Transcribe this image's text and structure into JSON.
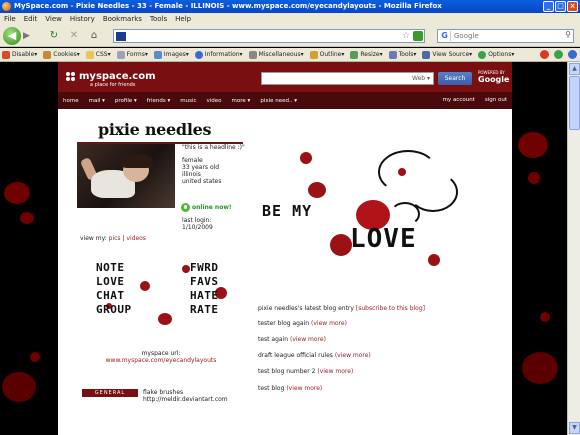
{
  "browser": {
    "title": "MySpace.com - Pixie Needles - 33 - Female - ILLINOIS - www.myspace.com/eyecandylayouts - Mozilla Firefox",
    "window_buttons": [
      "_",
      "□",
      "×"
    ],
    "menu": [
      "File",
      "Edit",
      "View",
      "History",
      "Bookmarks",
      "Tools",
      "Help"
    ],
    "search_placeholder": "Google",
    "webdev_toolbar": [
      "Disable▾",
      "Cookies▾",
      "CSS▾",
      "Forms▾",
      "Images▾",
      "Information▾",
      "Miscellaneous▾",
      "Outline▾",
      "Resize▾",
      "Tools▾",
      "View Source▾",
      "Options▾"
    ]
  },
  "myspace": {
    "logo": "myspace.com",
    "tagline": "a place for friends",
    "search_scope": "Web ▾",
    "search_button": "Search",
    "powered_by": "POWERED BY",
    "google": "Google",
    "nav": [
      "home",
      "mail ▾",
      "profile ▾",
      "friends ▾",
      "music",
      "video",
      "more ▾",
      "pixie need.. ▾"
    ],
    "nav_right": [
      "my account",
      "sign out"
    ]
  },
  "profile": {
    "name": "pixie needles",
    "headline": "\"this is a headline :)\"",
    "gender": "female",
    "age": "33 years old",
    "state": "illinois",
    "country": "united states",
    "online_now": "online now!",
    "last_login_label": "last login:",
    "last_login": "1/10/2009",
    "view_my": "view my:",
    "pics": "pics",
    "sep": "|",
    "videos": "videos"
  },
  "graphic_left": {
    "words_left": [
      "NOTE",
      "LOVE",
      "CHAT",
      "GROUP"
    ],
    "words_right": [
      "FWRD",
      "FAVS",
      "HATE",
      "RATE"
    ]
  },
  "graphic_love": {
    "be_my": "BE MY",
    "love": "LOVE"
  },
  "myspace_url": {
    "label": "myspace url:",
    "url": "www.myspace.com/eyecandylayouts"
  },
  "blog": {
    "heading": "pixie needles's latest blog entry",
    "subscribe": "[subscribe to this blog]",
    "view_more": "(view more)",
    "entries": [
      "tester blog again",
      "test again",
      "draft league official rules",
      "test blog number 2",
      "test blog"
    ]
  },
  "general": {
    "label": "GENERAL",
    "line1": "flake brushes",
    "line2": "http://meldir.deviantart.com"
  },
  "colors": {
    "accent": "#7a0f12",
    "link": "#9a1a1a",
    "online": "#1a9a1a"
  }
}
